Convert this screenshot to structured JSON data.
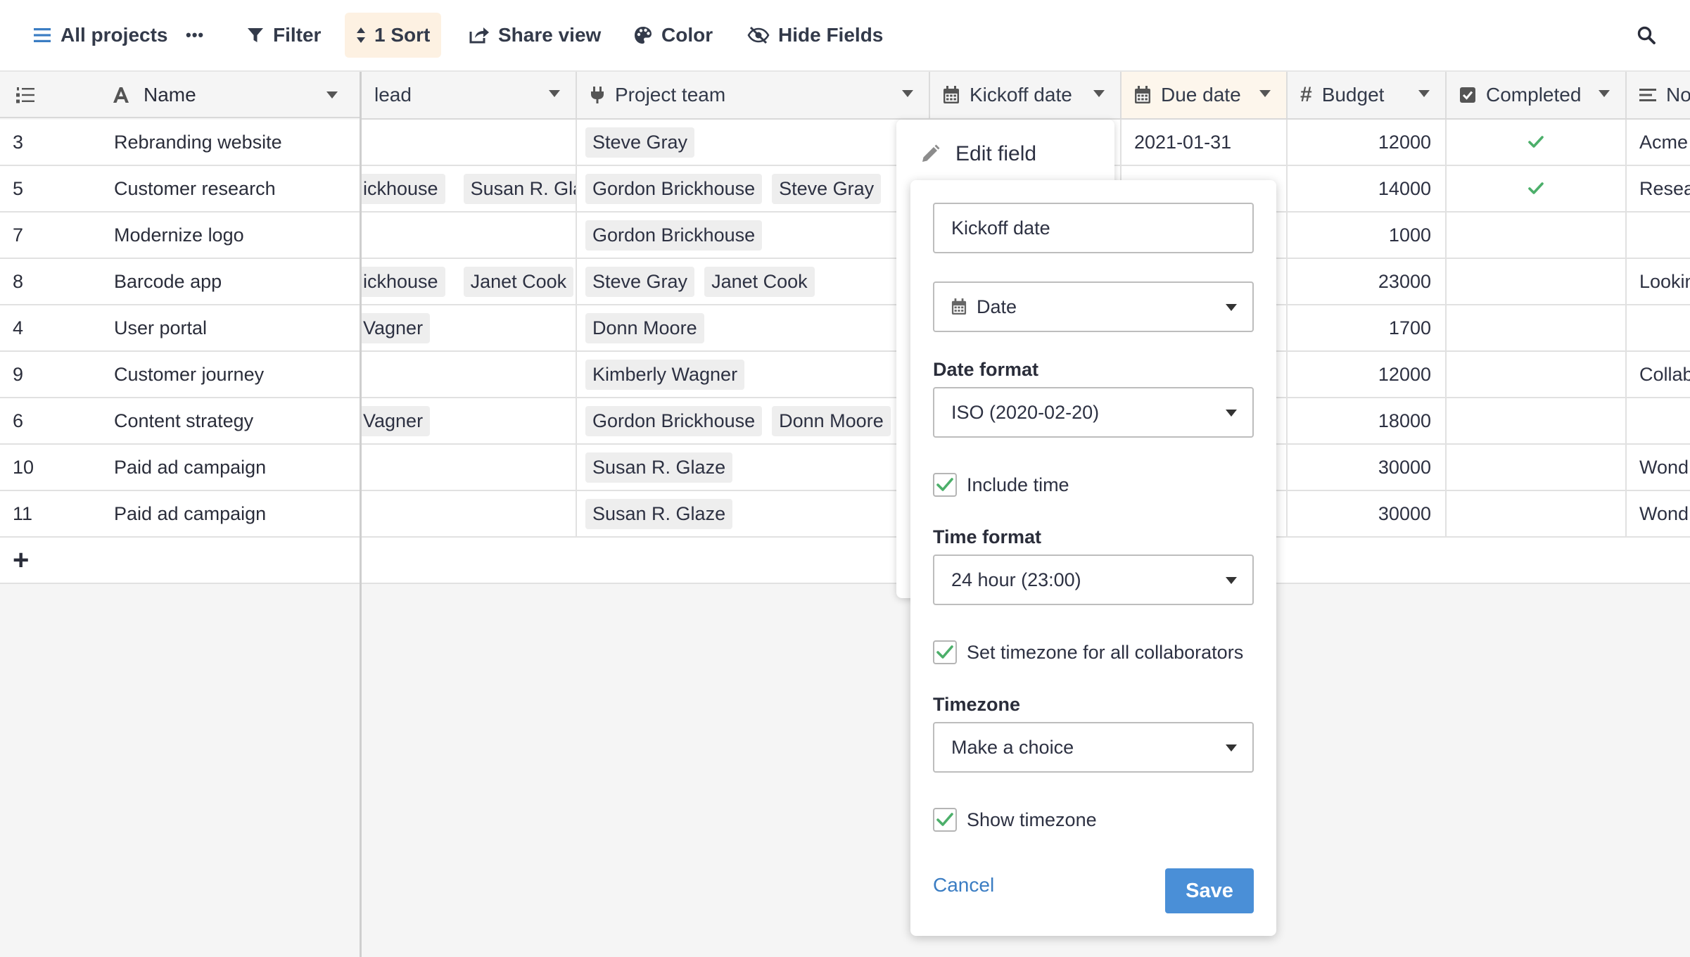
{
  "toolbar": {
    "view_name": "All projects",
    "more": "•••",
    "filter": "Filter",
    "sort": "1 Sort",
    "share": "Share view",
    "color": "Color",
    "hide": "Hide Fields"
  },
  "columns": {
    "name": "Name",
    "lead": "lead",
    "team": "Project team",
    "kickoff": "Kickoff date",
    "due": "Due date",
    "budget": "Budget",
    "completed": "Completed",
    "notes": "No"
  },
  "rows": [
    {
      "id": "3",
      "name": "Rebranding website",
      "lead": [],
      "team": [
        "Steve Gray"
      ],
      "due": "2021-01-31",
      "budget": "12000",
      "completed": true,
      "notes": "Acme"
    },
    {
      "id": "5",
      "name": "Customer research",
      "lead": [
        "ickhouse",
        "Susan R. Glaz"
      ],
      "team": [
        "Gordon Brickhouse",
        "Steve Gray"
      ],
      "due": "",
      "budget": "14000",
      "completed": true,
      "notes": "Resea"
    },
    {
      "id": "7",
      "name": "Modernize logo",
      "lead": [],
      "team": [
        "Gordon Brickhouse"
      ],
      "due": "",
      "budget": "1000",
      "completed": false,
      "notes": ""
    },
    {
      "id": "8",
      "name": "Barcode app",
      "lead": [
        "ickhouse",
        "Janet Cook"
      ],
      "team": [
        "Steve Gray",
        "Janet Cook"
      ],
      "due": "",
      "budget": "23000",
      "completed": false,
      "notes": "Lookin"
    },
    {
      "id": "4",
      "name": "User portal",
      "lead": [
        "Vagner"
      ],
      "team": [
        "Donn Moore"
      ],
      "due": "",
      "budget": "1700",
      "completed": false,
      "notes": ""
    },
    {
      "id": "9",
      "name": "Customer journey",
      "lead": [],
      "team": [
        "Kimberly Wagner"
      ],
      "due": "",
      "budget": "12000",
      "completed": false,
      "notes": "Collab"
    },
    {
      "id": "6",
      "name": "Content strategy",
      "lead": [
        "Vagner"
      ],
      "team": [
        "Gordon Brickhouse",
        "Donn Moore"
      ],
      "due": "",
      "budget": "18000",
      "completed": false,
      "notes": ""
    },
    {
      "id": "10",
      "name": "Paid ad campaign",
      "lead": [],
      "team": [
        "Susan R. Glaze"
      ],
      "due": "",
      "budget": "30000",
      "completed": false,
      "notes": "Wond"
    },
    {
      "id": "11",
      "name": "Paid ad campaign",
      "lead": [],
      "team": [
        "Susan R. Glaze"
      ],
      "due": "",
      "budget": "30000",
      "completed": false,
      "notes": "Wond"
    }
  ],
  "add_row": "+",
  "edit_menu": {
    "edit_field": "Edit field"
  },
  "field_panel": {
    "name_value": "Kickoff date",
    "type_value": "Date",
    "date_format_label": "Date format",
    "date_format_value": "ISO (2020-02-20)",
    "include_time_label": "Include time",
    "time_format_label": "Time format",
    "time_format_value": "24 hour (23:00)",
    "set_timezone_label": "Set timezone for all collaborators",
    "timezone_label": "Timezone",
    "timezone_value": "Make a choice",
    "show_timezone_label": "Show timezone",
    "cancel": "Cancel",
    "save": "Save"
  },
  "colors": {
    "accent": "#4a8fd7",
    "check": "#4caf6a",
    "sort_bg": "#fdf1e2"
  }
}
